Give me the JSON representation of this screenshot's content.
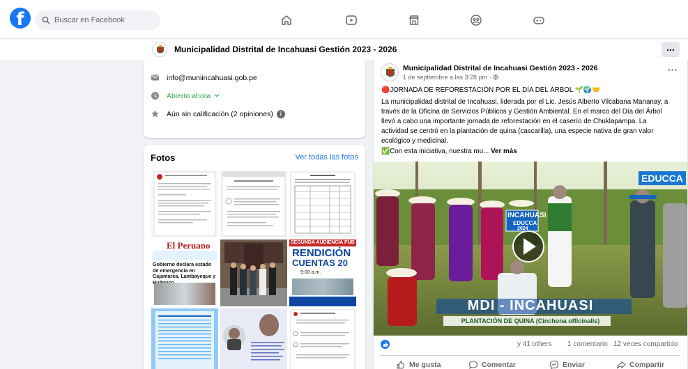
{
  "search": {
    "placeholder": "Buscar en Facebook"
  },
  "header": {
    "page_name": "Municipalidad Distrital de Incahuasi Gestión 2023 - 2026",
    "more_label": "..."
  },
  "info": {
    "email": "info@muniincahuasi.gob.pe",
    "hours": "Abierto ahora",
    "rating": "Aún sin calificación (2 opiniones)",
    "info_badge": "i"
  },
  "photos": {
    "title": "Fotos",
    "see_all": "Ver todas las fotos",
    "thumb_texts": {
      "peruano": "El Peruano",
      "peruano_headline": "Gobierno declara estado de emergencia en Cajamarca, Lambayeque y Huánuco",
      "rendicion_top": "SEGUNDA AUDIENCIA PUB",
      "rendicion_main": "RENDICIÓN",
      "rendicion_sub": "CUENTAS 20",
      "rendicion_time": "9:00 a.m."
    }
  },
  "post": {
    "author": "Municipalidad Distrital de Incahuasi Gestión 2023 - 2026",
    "time": "1 de septiembre a las 3:28 pm · ",
    "more_label": "···",
    "headline": "🔴JORNADA DE REFORESTACIÓN POR EL DÍA DEL ÁRBOL 🌱🌍🤝",
    "body": "La municipalidad distrital de Incahuasi, liderada por el Lic. Jesús Alberto Vilcabana Mananay, a través de la Oficina de Servicios Públicos y Gestión Ambiental. En el marco del Día del Árbol llevó a cabo una importante jornada de reforestación en el caserío de Chuklapampa. La actividad se centró en la plantación de quina (cascarilla), una especie nativa de gran valor ecológico y medicinal.",
    "more_line": "✅Con esta iniciativa, nuestra mu...",
    "see_more": "Ver más",
    "media": {
      "title": "MDI - INCAHUASI",
      "subtitle": "PLANTACIÓN DE QUINA (Cinchona officinalis)",
      "sign_line1": "INCAHUASI",
      "sign_line2": "EDUCCA",
      "sign_line3": "2024",
      "logo": "EDUCCA"
    },
    "stats": {
      "reactions": "y 41 others",
      "comments": "1 comentario",
      "shares": "12 veces compartido"
    },
    "actions": {
      "like": "Me gusta",
      "comment": "Comentar",
      "send": "Enviar",
      "share": "Compartir"
    }
  },
  "colors": {
    "facebook_blue": "#1877f2",
    "open_green": "#31a24c",
    "text_secondary": "#65676b"
  }
}
